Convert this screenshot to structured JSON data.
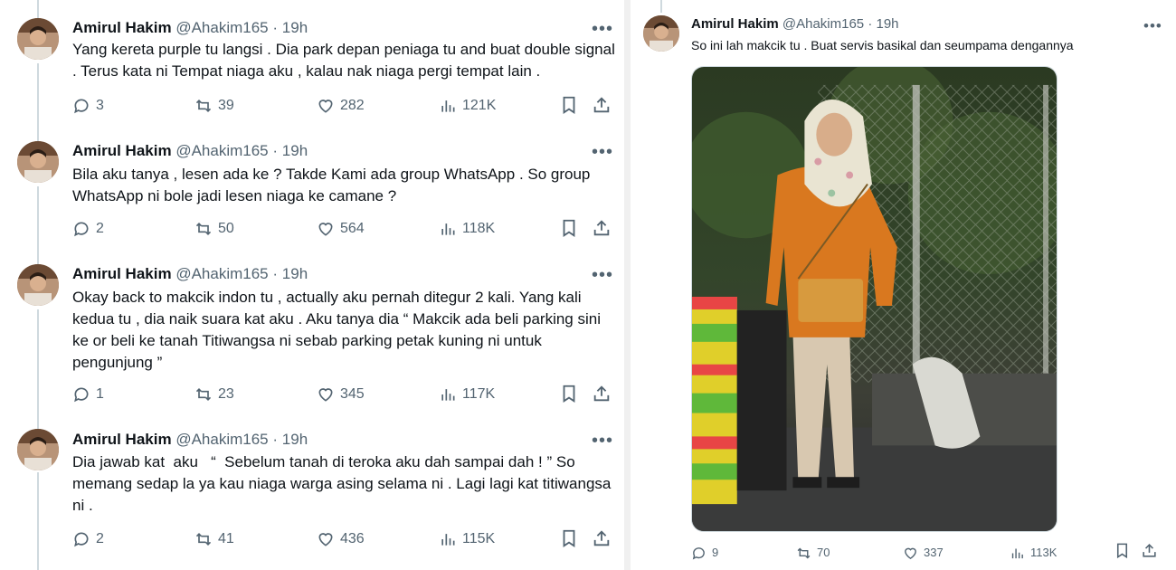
{
  "tweets_left": [
    {
      "name": "Amirul Hakim",
      "handle": "@Ahakim165",
      "time": "19h",
      "text": "Yang kereta purple tu langsi . Dia park depan peniaga tu and buat double signal . Terus kata ni Tempat niaga aku , kalau nak niaga pergi tempat lain .",
      "replies": "3",
      "retweets": "39",
      "likes": "282",
      "views": "121K"
    },
    {
      "name": "Amirul Hakim",
      "handle": "@Ahakim165",
      "time": "19h",
      "text": "Bila aku tanya , lesen ada ke ? Takde Kami ada group WhatsApp . So group WhatsApp ni bole jadi lesen niaga ke camane ?",
      "replies": "2",
      "retweets": "50",
      "likes": "564",
      "views": "118K"
    },
    {
      "name": "Amirul Hakim",
      "handle": "@Ahakim165",
      "time": "19h",
      "text": "Okay back to makcik indon tu , actually aku pernah ditegur 2 kali. Yang kali kedua tu , dia naik suara kat aku . Aku tanya dia “ Makcik ada beli parking sini ke or beli ke tanah Titiwangsa ni sebab parking petak kuning ni untuk pengunjung ”",
      "replies": "1",
      "retweets": "23",
      "likes": "345",
      "views": "117K"
    },
    {
      "name": "Amirul Hakim",
      "handle": "@Ahakim165",
      "time": "19h",
      "text": "Dia jawab kat  aku   “  Sebelum tanah di teroka aku dah sampai dah ! ” So memang sedap la ya kau niaga warga asing selama ni . Lagi lagi kat titiwangsa ni .",
      "replies": "2",
      "retweets": "41",
      "likes": "436",
      "views": "115K"
    }
  ],
  "tweet_right": {
    "name": "Amirul Hakim",
    "handle": "@Ahakim165",
    "time": "19h",
    "text": "So ini lah makcik tu . Buat servis basikal dan seumpama dengannya",
    "replies": "9",
    "retweets": "70",
    "likes": "337",
    "views": "113K"
  },
  "ui": {
    "separator": "·",
    "more": "•••"
  },
  "icons": [
    "reply-icon",
    "retweet-icon",
    "like-icon",
    "views-icon",
    "bookmark-icon",
    "share-icon",
    "more-icon"
  ],
  "colors": {
    "text_primary": "#0f1419",
    "text_secondary": "#536471",
    "thread_line": "#cfd9de"
  }
}
